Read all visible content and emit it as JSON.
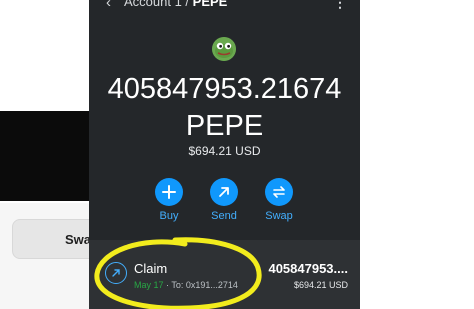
{
  "background": {
    "swap_label": "Swa"
  },
  "header": {
    "breadcrumb_account": "Account 1 /",
    "breadcrumb_token": "PEPE"
  },
  "token": {
    "balance": "405847953.21674",
    "symbol": "PEPE",
    "fiat_value": "$694.21 USD",
    "logo_icon": "pepe-frog-icon"
  },
  "actions": [
    {
      "label": "Buy",
      "icon": "plus-icon"
    },
    {
      "label": "Send",
      "icon": "arrow-up-right-icon"
    },
    {
      "label": "Swap",
      "icon": "swap-arrows-icon"
    }
  ],
  "activity": {
    "title": "Claim",
    "date": "May 17",
    "to": "· To: 0x191...2714",
    "amount": "405847953....",
    "fiat": "$694.21 USD"
  },
  "colors": {
    "wallet_bg": "#24272a",
    "accent_blue": "#1098fc",
    "highlight_yellow": "#f2ec1d",
    "date_green": "#28a745"
  }
}
